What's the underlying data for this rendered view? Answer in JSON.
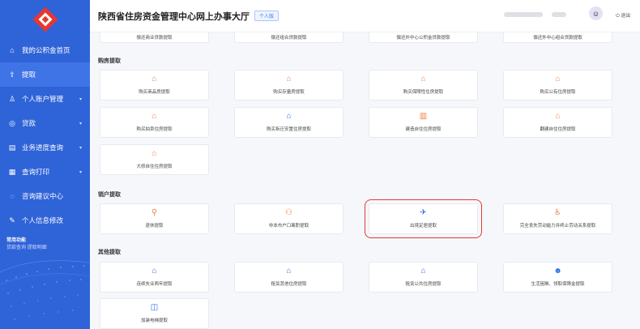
{
  "colors": {
    "sidebar": "#2f63d8",
    "accent": "#3e7ef0",
    "orange_icon": "#f0834c",
    "blue_icon": "#2f73e6",
    "highlight": "#e43a33"
  },
  "app": {
    "title": "陕西省住房资金管理中心网上办事大厅",
    "tag": "个人版",
    "logout": "退出"
  },
  "sidebar": {
    "items": [
      {
        "label": "我的公积金首页",
        "icon": "home-icon"
      },
      {
        "label": "提取",
        "icon": "upload-icon"
      },
      {
        "label": "个人账户管理",
        "icon": "user-icon"
      },
      {
        "label": "贷款",
        "icon": "loan-icon"
      },
      {
        "label": "业务进度查询",
        "icon": "progress-icon"
      },
      {
        "label": "查询打印",
        "icon": "print-icon"
      },
      {
        "label": "咨询建议中心",
        "icon": "chat-icon"
      },
      {
        "label": "个人信息修改",
        "icon": "edit-icon"
      }
    ],
    "common_title": "常用功能",
    "common_links": "贷款查询  提取明细"
  },
  "top_row": [
    "偿还商业贷款提取",
    "偿还组合贷款提取",
    "偿还外中心公积金贷款提取",
    "偿还外中心组合贷款提取"
  ],
  "sections": {
    "purchase": {
      "title": "购房提取",
      "cards": [
        {
          "label": "购买商品房提取",
          "icon": "house-icon"
        },
        {
          "label": "购买存量房提取",
          "icon": "house-icon"
        },
        {
          "label": "购买保障性住房提取",
          "icon": "house-icon"
        },
        {
          "label": "购买公有住房提取",
          "icon": "house-icon"
        },
        {
          "label": "购买拍卖住房提取",
          "icon": "house-icon"
        },
        {
          "label": "购买拆迁安置住房提取",
          "icon": "house-icon"
        },
        {
          "label": "建造自住住房提取",
          "icon": "building-icon"
        },
        {
          "label": "翻建自住住房提取",
          "icon": "house-icon"
        },
        {
          "label": "大修自住住房提取",
          "icon": "house-icon"
        }
      ]
    },
    "closing": {
      "title": "销户提取",
      "cards": [
        {
          "label": "退休提取",
          "icon": "retire-icon"
        },
        {
          "label": "非本市户口离职提取",
          "icon": "people-icon"
        },
        {
          "label": "出境定居提取",
          "icon": "plane-icon"
        },
        {
          "label": "完全丧失劳动能力并终止劳动关系提取",
          "icon": "wheelchair-icon"
        }
      ]
    },
    "other": {
      "title": "其他提取",
      "cards": [
        {
          "label": "连续失业两年提取",
          "icon": "house-icon"
        },
        {
          "label": "租赁其他住房提取",
          "icon": "house-icon"
        },
        {
          "label": "租赁公共住房提取",
          "icon": "house-icon"
        },
        {
          "label": "生活困难、领取保障金提取",
          "icon": "person-icon"
        },
        {
          "label": "加装电梯提取",
          "icon": "elevator-icon"
        }
      ]
    }
  }
}
